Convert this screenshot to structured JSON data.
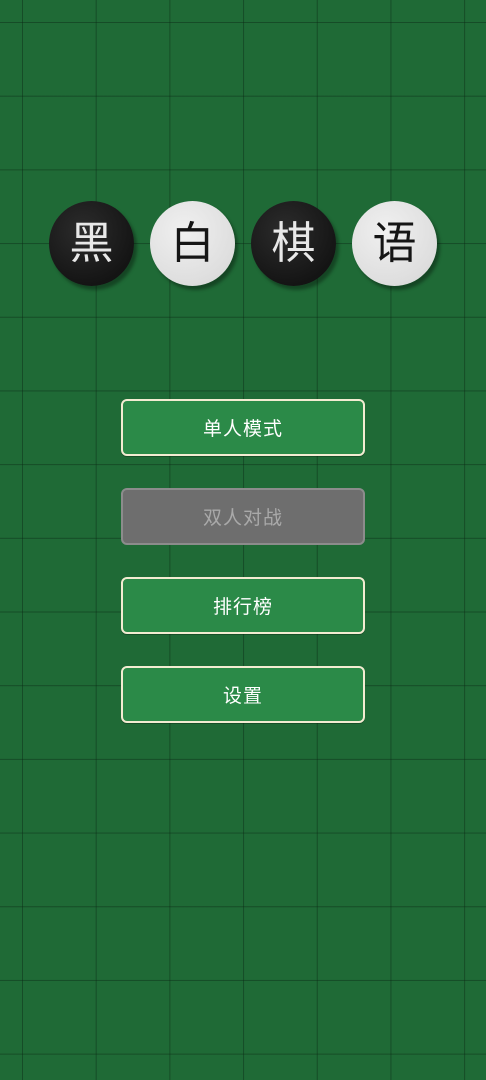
{
  "title": {
    "stones": [
      {
        "char": "黑",
        "color": "black"
      },
      {
        "char": "白",
        "color": "white"
      },
      {
        "char": "棋",
        "color": "black"
      },
      {
        "char": "语",
        "color": "white"
      }
    ]
  },
  "menu": {
    "single_player": "单人模式",
    "two_player": "双人对战",
    "two_player_enabled": false,
    "leaderboard": "排行榜",
    "settings": "设置"
  },
  "colors": {
    "board_background": "#1f6a36",
    "button_green": "#2b8a48",
    "button_disabled": "#6e6e6e",
    "button_border": "#f3ecd2"
  }
}
